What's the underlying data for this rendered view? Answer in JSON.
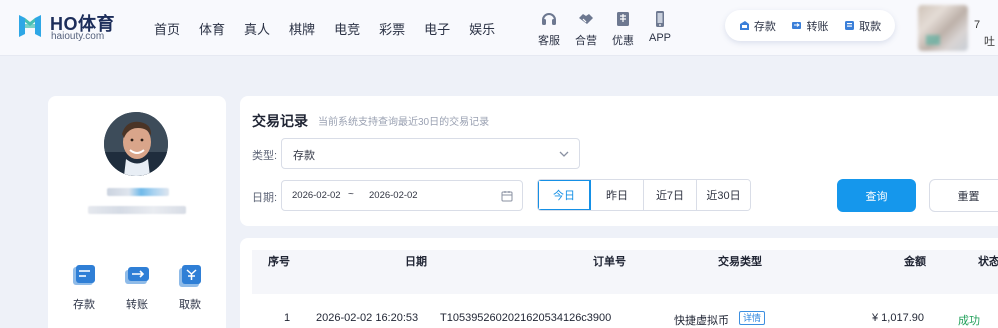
{
  "header": {
    "brand": "HO体育",
    "domain": "haiouty.com",
    "nav": [
      "首页",
      "体育",
      "真人",
      "棋牌",
      "电竞",
      "彩票",
      "电子",
      "娱乐"
    ],
    "quick_links": [
      {
        "label": "客服",
        "icon": "headset-icon"
      },
      {
        "label": "合营",
        "icon": "handshake-icon"
      },
      {
        "label": "优惠",
        "icon": "gift-icon"
      },
      {
        "label": "APP",
        "icon": "phone-icon"
      }
    ],
    "wallet": [
      {
        "label": "存款",
        "icon": "deposit-icon"
      },
      {
        "label": "转账",
        "icon": "transfer-icon"
      },
      {
        "label": "取款",
        "icon": "withdraw-icon"
      }
    ],
    "user_name_fragment": "7",
    "user_sub_fragment": "吐"
  },
  "profile": {
    "actions": [
      {
        "label": "存款",
        "icon": "deposit-card-icon"
      },
      {
        "label": "转账",
        "icon": "transfer-card-icon"
      },
      {
        "label": "取款",
        "icon": "withdraw-card-icon"
      }
    ]
  },
  "filter": {
    "title": "交易记录",
    "note": "当前系统支持查询最近30日的交易记录",
    "type_label": "类型:",
    "type_value": "存款",
    "date_label": "日期:",
    "date_start": "2026-02-02",
    "date_sep": "~",
    "date_end": "2026-02-02",
    "quick_dates": [
      "今日",
      "昨日",
      "近7日",
      "近30日"
    ],
    "active_quick_date": "今日",
    "query_label": "查询",
    "reset_label": "重置"
  },
  "table": {
    "headers": [
      "序号",
      "日期",
      "订单号",
      "交易类型",
      "金额",
      "状态"
    ],
    "rows": [
      {
        "index": "1",
        "date": "2026-02-02 16:20:53",
        "order_no": "T1053952602021620534126c3900",
        "type": "快捷虚拟币",
        "detail": "详情",
        "amount": "¥ 1,017.90",
        "status": "成功"
      }
    ]
  },
  "colors": {
    "accent": "#1597ec",
    "success": "#21a05a",
    "page_bg": "#eef1f8"
  }
}
